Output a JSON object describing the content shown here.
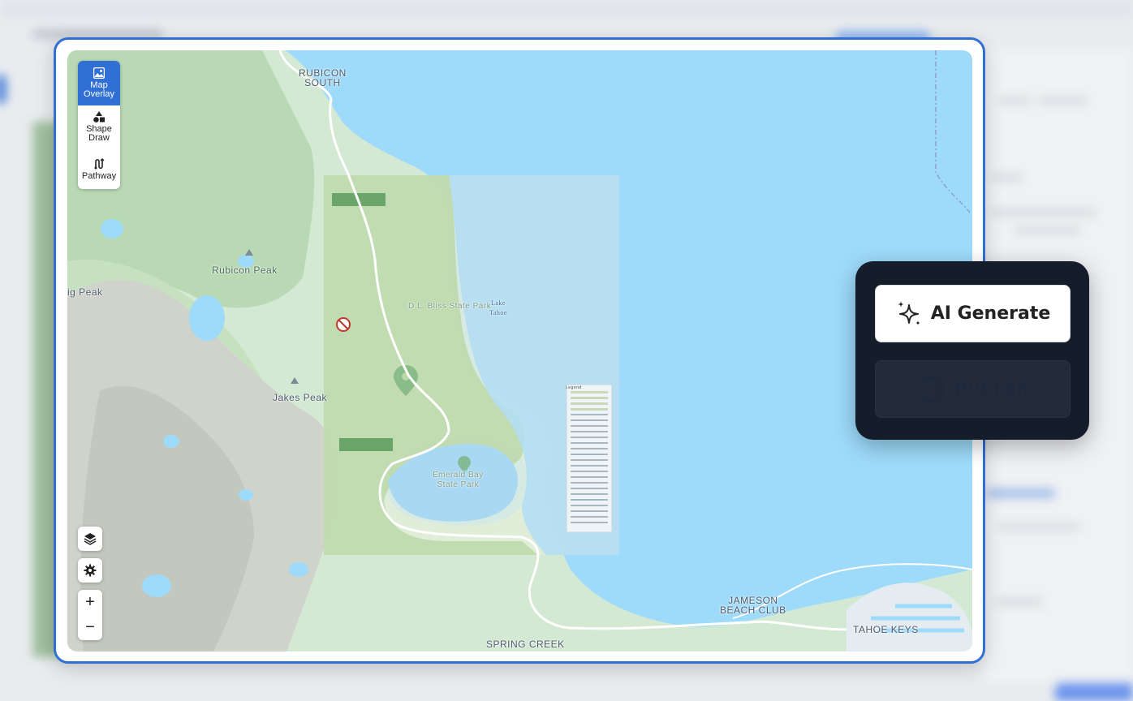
{
  "toolbar": {
    "tools": [
      {
        "label_line1": "Map",
        "label_line2": "Overlay",
        "icon": "image-icon",
        "active": true
      },
      {
        "label_line1": "Shape",
        "label_line2": "Draw",
        "icon": "shapes-icon",
        "active": false
      },
      {
        "label_line1": "Pathway",
        "icon": "route-icon",
        "active": false
      }
    ]
  },
  "map": {
    "labels": {
      "rubicon_south_1": "RUBICON",
      "rubicon_south_2": "SOUTH",
      "rubicon_peak": "Rubicon Peak",
      "jakes_peak": "Jakes Peak",
      "ig_peak": "ig Peak",
      "jameson_1": "JAMESON",
      "jameson_2": "BEACH CLUB",
      "tahoe_keys": "TAHOE KEYS",
      "spring_creek": "SPRING CREEK",
      "dl_bliss": "D.L. Bliss State Park",
      "emerald_1": "Emerald Bay",
      "emerald_2": "State Park",
      "lake_1": "Lake",
      "lake_2": "Tahoe",
      "legend": "Legend"
    },
    "controls": {
      "layers": "layers-icon",
      "settings": "gear-icon",
      "zoom_in": "+",
      "zoom_out": "−"
    }
  },
  "ai_panel": {
    "generate_label": "AI Generate",
    "publish_label": "Publish"
  },
  "colors": {
    "accent": "#2f6fd6",
    "water": "#9edbfb",
    "land": "#d3e9d3",
    "panel_dark": "#151c2a"
  }
}
